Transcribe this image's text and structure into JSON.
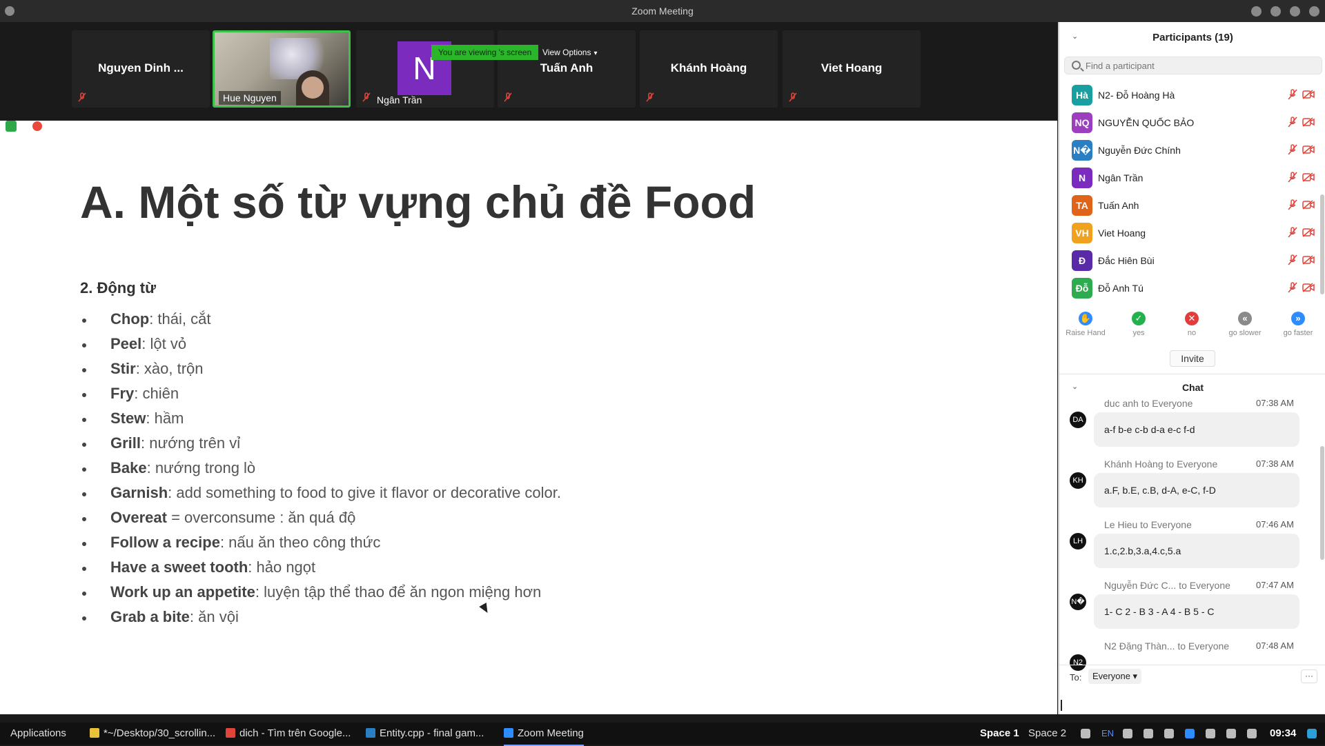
{
  "window": {
    "title": "Zoom Meeting"
  },
  "video_strip": {
    "tiles": [
      {
        "name": "Nguyen Dinh ..."
      },
      {
        "name": "Hue Nguyen"
      },
      {
        "name": "Ngân Trần",
        "initial": "N"
      },
      {
        "name": "Tuấn Anh"
      },
      {
        "name": "Khánh Hoàng"
      },
      {
        "name": "Viet Hoang"
      }
    ],
    "share_banner": "You are viewing 's screen",
    "view_options": "View Options"
  },
  "slide": {
    "title": "A. Một số từ vựng chủ đề Food",
    "subtitle": "2. Động từ",
    "items": [
      {
        "term": "Chop",
        "def": ": thái, cắt"
      },
      {
        "term": "Peel",
        "def": ": lột vỏ"
      },
      {
        "term": "Stir",
        "def": ": xào, trộn"
      },
      {
        "term": "Fry",
        "def": ": chiên"
      },
      {
        "term": "Stew",
        "def": ": hầm"
      },
      {
        "term": "Grill",
        "def": ": nướng trên vỉ"
      },
      {
        "term": "Bake",
        "def": ": nướng trong lò"
      },
      {
        "term": "Garnish",
        "def": ": add something to food to give it flavor or decorative color."
      },
      {
        "term": "Overeat",
        "def": " = overconsume : ăn quá độ"
      },
      {
        "term": "Follow a recipe",
        "def": ": nấu ăn theo công thức"
      },
      {
        "term": "Have a sweet tooth",
        "def": ": hảo ngọt"
      },
      {
        "term": "Work up an appetite",
        "def": ": luyện tập thể thao để ăn ngon miệng hơn"
      },
      {
        "term": "Grab a bite",
        "def": ": ăn vội"
      }
    ]
  },
  "participants": {
    "header": "Participants (19)",
    "search_placeholder": "Find a participant",
    "list": [
      {
        "initials": "Hà",
        "name": "N2- Đỗ Hoàng Hà",
        "color": "#1a9fa0"
      },
      {
        "initials": "NQ",
        "name": "NGUYỄN QUỐC BẢO",
        "color": "#9b3fbf"
      },
      {
        "initials": "N�",
        "name": "Nguyễn Đức Chính",
        "color": "#2a7ec2"
      },
      {
        "initials": "N",
        "name": "Ngân Trần",
        "color": "#7b2bbd"
      },
      {
        "initials": "TA",
        "name": "Tuấn Anh",
        "color": "#e0631a"
      },
      {
        "initials": "VH",
        "name": "Viet Hoang",
        "color": "#f0a21e"
      },
      {
        "initials": "Đ",
        "name": "Đắc Hiên Bùi",
        "color": "#5a2ba8"
      },
      {
        "initials": "Đỗ",
        "name": "Đỗ Anh Tú",
        "color": "#2eaa4f"
      }
    ],
    "reactions": [
      {
        "label": "Raise Hand",
        "icon": "raise-hand-icon",
        "glyph": "✋",
        "color": "#2d8cff"
      },
      {
        "label": "yes",
        "icon": "check-icon",
        "glyph": "✓",
        "color": "#22b14c"
      },
      {
        "label": "no",
        "icon": "x-icon",
        "glyph": "✕",
        "color": "#e23d3d"
      },
      {
        "label": "go slower",
        "icon": "rewind-icon",
        "glyph": "«",
        "color": "#8a8a8a"
      },
      {
        "label": "go faster",
        "icon": "fast-forward-icon",
        "glyph": "»",
        "color": "#2d8cff"
      }
    ],
    "invite": "Invite"
  },
  "chat": {
    "header": "Chat",
    "messages": [
      {
        "avatar": "DA",
        "from": "duc anh to Everyone",
        "time": "07:38 AM",
        "text": "a-f b-e c-b d-a e-c f-d"
      },
      {
        "avatar": "KH",
        "from": "Khánh Hoàng to Everyone",
        "time": "07:38 AM",
        "text": "a.F, b.E, c.B, d-A, e-C, f-D"
      },
      {
        "avatar": "LH",
        "from": "Le Hieu to Everyone",
        "time": "07:46 AM",
        "text": "1.c,2.b,3.a,4.c,5.a"
      },
      {
        "avatar": "N�",
        "from": "Nguyễn Đức C... to Everyone",
        "time": "07:47 AM",
        "text": "1- C 2 - B 3 - A 4 - B 5 - C"
      },
      {
        "avatar": "N2",
        "from": "N2 Đặng Thàn... to Everyone",
        "time": "07:48 AM",
        "text": ""
      }
    ],
    "to_label": "To:",
    "to_value": "Everyone",
    "more": "···"
  },
  "taskbar": {
    "applications": "Applications",
    "items": [
      {
        "label": "*~/Desktop/30_scrollin...",
        "icon": "editor-icon",
        "color": "#e8c33a"
      },
      {
        "label": "dich - Tìm trên Google...",
        "icon": "chrome-icon",
        "color": "#e0443a"
      },
      {
        "label": "Entity.cpp - final gam...",
        "icon": "vscode-icon",
        "color": "#2a7ec2"
      },
      {
        "label": "Zoom Meeting",
        "icon": "zoom-icon",
        "color": "#2d8cff"
      }
    ],
    "space1": "Space 1",
    "space2": "Space 2",
    "lang": "EN",
    "clock": "09:34"
  }
}
